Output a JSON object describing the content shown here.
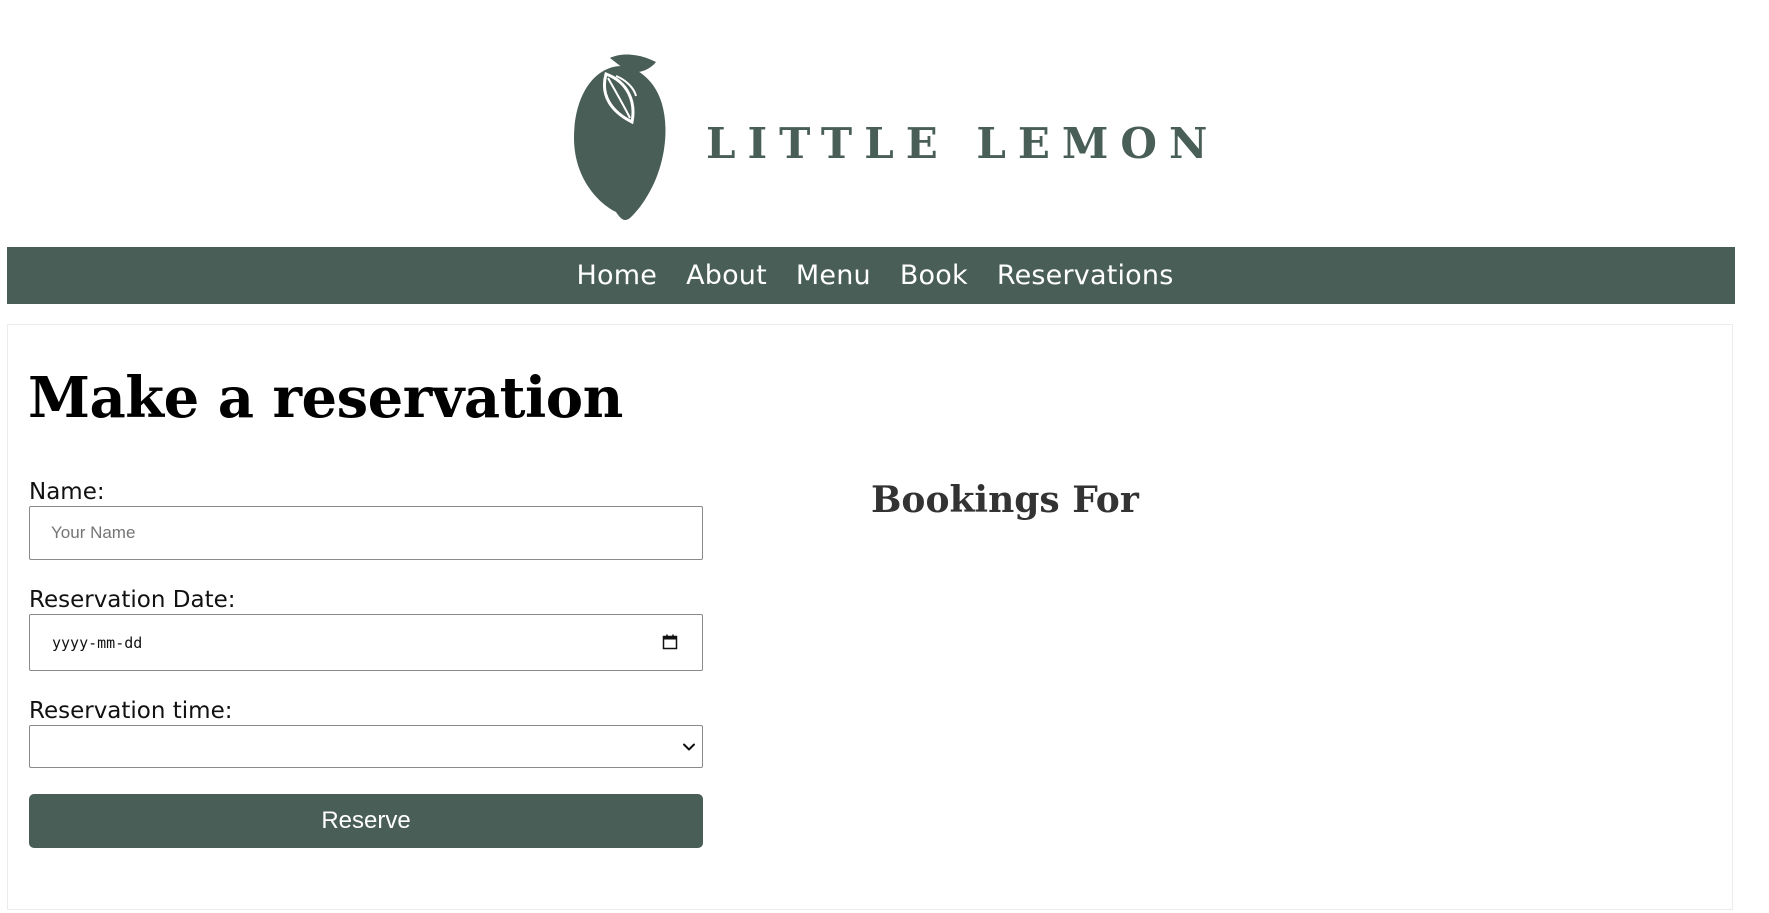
{
  "brand": {
    "name": "LITTLE LEMON",
    "logo_icon": "lemon-icon",
    "color": "#495e57"
  },
  "nav": {
    "items": [
      {
        "label": "Home"
      },
      {
        "label": "About"
      },
      {
        "label": "Menu"
      },
      {
        "label": "Book"
      },
      {
        "label": "Reservations"
      }
    ]
  },
  "main": {
    "title": "Make a reservation",
    "form": {
      "name_label": "Name:",
      "name_placeholder": "Your Name",
      "name_value": "",
      "date_label": "Reservation Date:",
      "date_placeholder": "yyyy-mm-dd",
      "date_icon": "calendar-icon",
      "time_label": "Reservation time:",
      "time_value": "",
      "time_icon": "chevron-down-icon",
      "submit_label": "Reserve"
    },
    "bookings_title": "Bookings For"
  },
  "colors": {
    "accent": "#495e57",
    "background": "#ffffff",
    "heading": "#000000",
    "subheading": "#333333"
  }
}
